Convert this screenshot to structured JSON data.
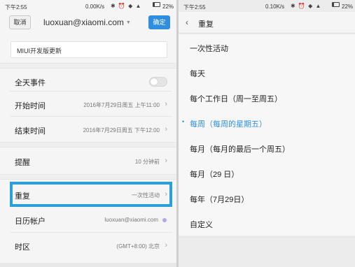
{
  "left": {
    "status": {
      "time": "下午2:55",
      "speed": "0.00K/s",
      "battery": "22%"
    },
    "cancel_label": "取消",
    "confirm_label": "确定",
    "account": "luoxuan@xiaomi.com",
    "title_value": "MIUI开发版更新",
    "rows": {
      "allday": {
        "label": "全天事件"
      },
      "start": {
        "label": "开始时间",
        "value": "2016年7月29日周五 上午11:00"
      },
      "end": {
        "label": "结束时间",
        "value": "2016年7月29日周五 下午12:00"
      },
      "reminder": {
        "label": "提醒",
        "value": "10 分钟前"
      },
      "repeat": {
        "label": "重复",
        "value": "一次性活动"
      },
      "calendar": {
        "label": "日历帐户",
        "value": "luoxuan@xiaomi.com"
      },
      "timezone": {
        "label": "时区",
        "value": "(GMT+8:00) 北京"
      }
    }
  },
  "right": {
    "status": {
      "time": "下午2:55",
      "speed": "0.10K/s",
      "battery": "22%"
    },
    "title": "重复",
    "options": [
      "一次性活动",
      "每天",
      "每个工作日（周一至周五）",
      "每周（每周的星期五）",
      "每月（每月的最后一个周五）",
      "每月（29 日）",
      "每年（7月29日）",
      "自定义"
    ],
    "selected_index": 3
  },
  "colors": {
    "accent": "#2f8fde",
    "highlight_border": "#2a9fd8"
  },
  "icons": {
    "back": "chevron-left-icon",
    "row_chevron": "chevron-right-icon"
  }
}
